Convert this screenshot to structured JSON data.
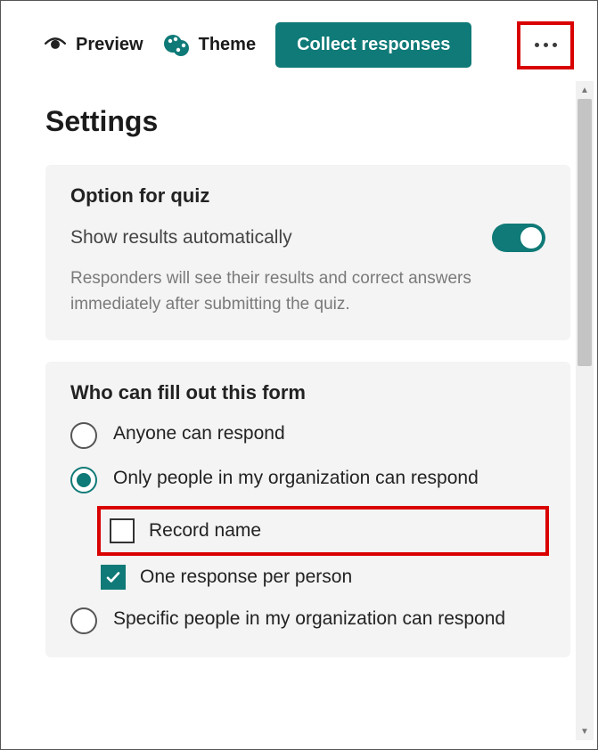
{
  "toolbar": {
    "preview_label": "Preview",
    "theme_label": "Theme",
    "collect_label": "Collect responses"
  },
  "page": {
    "title": "Settings"
  },
  "quiz_card": {
    "heading": "Option for quiz",
    "toggle_label": "Show results automatically",
    "toggle_on": true,
    "description": "Responders will see their results and correct answers immediately after submitting the quiz."
  },
  "access_card": {
    "heading": "Who can fill out this form",
    "options": [
      {
        "label": "Anyone can respond",
        "selected": false
      },
      {
        "label": "Only people in my organization can respond",
        "selected": true
      },
      {
        "label": "Specific people in my organization can respond",
        "selected": false
      }
    ],
    "sub_options": {
      "record_name": {
        "label": "Record name",
        "checked": false
      },
      "one_response": {
        "label": "One response per person",
        "checked": true
      }
    }
  },
  "colors": {
    "accent": "#0f7a77",
    "highlight": "#d90000"
  }
}
